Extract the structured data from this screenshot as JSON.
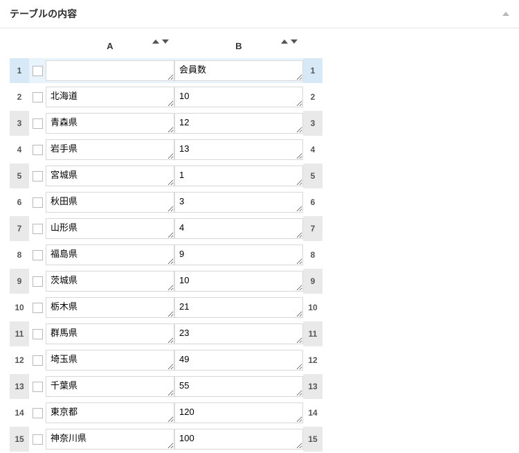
{
  "panel": {
    "title": "テーブルの内容"
  },
  "columns": {
    "a": "A",
    "b": "B"
  },
  "rows": [
    {
      "n": "1",
      "a": "",
      "b": "会員数"
    },
    {
      "n": "2",
      "a": "北海道",
      "b": "10"
    },
    {
      "n": "3",
      "a": "青森県",
      "b": "12"
    },
    {
      "n": "4",
      "a": "岩手県",
      "b": "13"
    },
    {
      "n": "5",
      "a": "宮城県",
      "b": "1"
    },
    {
      "n": "6",
      "a": "秋田県",
      "b": "3"
    },
    {
      "n": "7",
      "a": "山形県",
      "b": "4"
    },
    {
      "n": "8",
      "a": "福島県",
      "b": "9"
    },
    {
      "n": "9",
      "a": "茨城県",
      "b": "10"
    },
    {
      "n": "10",
      "a": "栃木県",
      "b": "21"
    },
    {
      "n": "11",
      "a": "群馬県",
      "b": "23"
    },
    {
      "n": "12",
      "a": "埼玉県",
      "b": "49"
    },
    {
      "n": "13",
      "a": "千葉県",
      "b": "55"
    },
    {
      "n": "14",
      "a": "東京都",
      "b": "120"
    },
    {
      "n": "15",
      "a": "神奈川県",
      "b": "100"
    }
  ]
}
